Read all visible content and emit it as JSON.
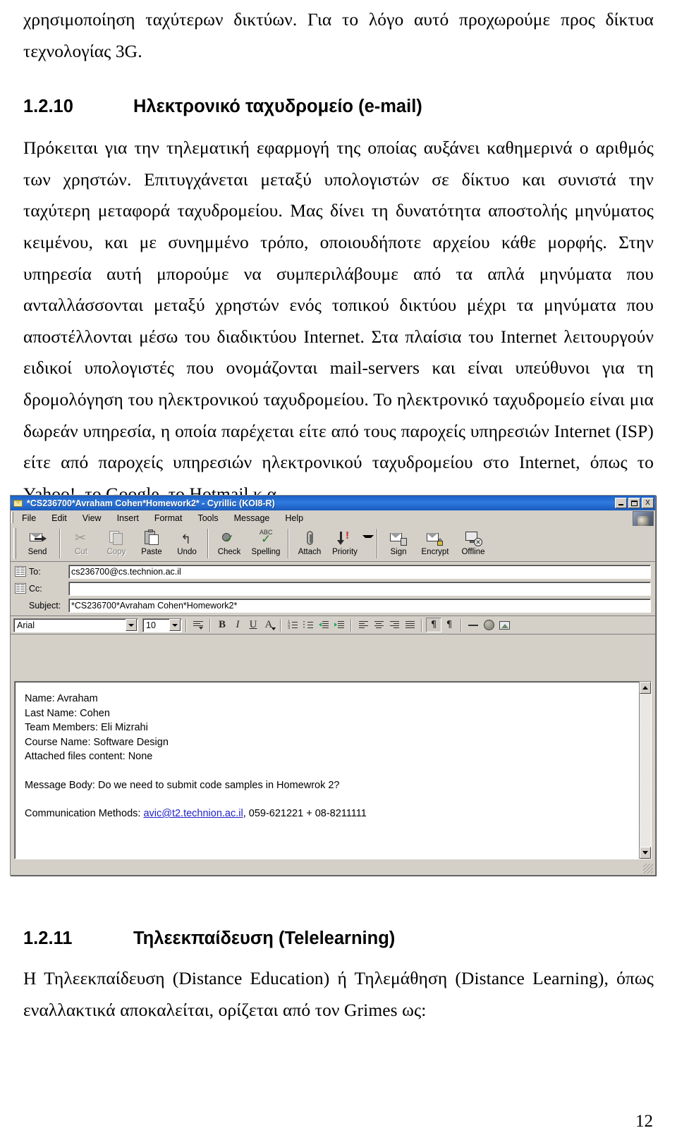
{
  "document": {
    "paragraph_intro": "χρησιμοποίηση ταχύτερων δικτύων. Για το λόγο αυτό προχωρούμε προς δίκτυα τεχνολογίας 3G.",
    "heading_1210": {
      "number": "1.2.10",
      "text": "Ηλεκτρονικό ταχυδρομείο (e-mail)"
    },
    "paragraph_body": "Πρόκειται για την τηλεματική εφαρμογή της οποίας αυξάνει καθημερινά ο αριθμός των χρηστών. Επιτυγχάνεται μεταξύ υπολογιστών σε δίκτυο και συνιστά την ταχύτερη μεταφορά ταχυδρομείου. Μας δίνει τη δυνατότητα αποστολής μηνύματος κειμένου, και με συνημμένο τρόπο, οποιουδήποτε αρχείου κάθε μορφής. Στην υπηρεσία αυτή μπορούμε να συμπεριλάβουμε από τα απλά μηνύματα που ανταλλάσσονται μεταξύ χρηστών ενός τοπικού δικτύου μέχρι τα μηνύματα που αποστέλλονται μέσω του διαδικτύου Internet. Στα πλαίσια του Internet λειτουργούν ειδικοί υπολογιστές που ονομάζονται mail-servers και είναι υπεύθυνοι για τη δρομολόγηση του ηλεκτρονικού ταχυδρομείου. Το ηλεκτρονικό ταχυδρομείο είναι μια δωρεάν υπηρεσία, η οποία παρέχεται είτε από τους παροχείς υπηρεσιών Internet (ISP) είτε από παροχείς υπηρεσιών ηλεκτρονικού ταχυδρομείου στο Internet, όπως το Yahoo!, το Google, το Hotmail κ.α.",
    "heading_1211": {
      "number": "1.2.11",
      "text": "Τηλεεκπαίδευση (Telelearning)"
    },
    "paragraph_tail": "Η Τηλεεκπαίδευση (Distance Education) ή Τηλεμάθηση (Distance Learning), όπως εναλλακτικά αποκαλείται, ορίζεται από τον Grimes ως:",
    "page_number": "12"
  },
  "mail_window": {
    "title": "*CS236700*Avraham Cohen*Homework2* - Cyrillic (KOI8-R)",
    "window_buttons": {
      "minimize": "_",
      "maximize": "□",
      "close": "X"
    },
    "menu": [
      {
        "label": "File",
        "accel": "F"
      },
      {
        "label": "Edit",
        "accel": "E"
      },
      {
        "label": "View",
        "accel": "V"
      },
      {
        "label": "Insert",
        "accel": "I"
      },
      {
        "label": "Format",
        "accel": "o"
      },
      {
        "label": "Tools",
        "accel": "T"
      },
      {
        "label": "Message",
        "accel": "M"
      },
      {
        "label": "Help",
        "accel": "H"
      }
    ],
    "toolbar": [
      {
        "label": "Send",
        "icon": "send-icon",
        "enabled": true
      },
      {
        "label": "Cut",
        "icon": "cut-icon",
        "enabled": false
      },
      {
        "label": "Copy",
        "icon": "copy-icon",
        "enabled": false
      },
      {
        "label": "Paste",
        "icon": "paste-icon",
        "enabled": true
      },
      {
        "label": "Undo",
        "icon": "undo-icon",
        "enabled": true
      },
      {
        "label": "Check",
        "icon": "check-names-icon",
        "enabled": true
      },
      {
        "label": "Spelling",
        "icon": "spelling-icon",
        "enabled": true
      },
      {
        "label": "Attach",
        "icon": "attach-icon",
        "enabled": true
      },
      {
        "label": "Priority",
        "icon": "priority-icon",
        "enabled": true
      },
      {
        "label": "Sign",
        "icon": "sign-icon",
        "enabled": true
      },
      {
        "label": "Encrypt",
        "icon": "encrypt-icon",
        "enabled": true
      },
      {
        "label": "Offline",
        "icon": "offline-icon",
        "enabled": true
      }
    ],
    "fields": {
      "to_label": "To:",
      "to_value": "cs236700@cs.technion.ac.il",
      "cc_label": "Cc:",
      "cc_value": "",
      "subject_label": "Subject:",
      "subject_value": "*CS236700*Avraham Cohen*Homework2*"
    },
    "format_toolbar": {
      "font_family": "Arial",
      "font_size": "10",
      "bold": "B",
      "italic": "I",
      "underline": "U",
      "font_color": "A"
    },
    "body": {
      "line_name": "Name: Avraham",
      "line_last_name": "Last Name: Cohen",
      "line_team": "Team Members: Eli Mizrahi",
      "line_course": "Course Name: Software Design",
      "line_attached": "Attached files content: None",
      "line_message": "Message Body: Do we need to submit code samples in Homewrok 2?",
      "line_comm_prefix": "Communication Methods: ",
      "line_comm_email": "avic@t2.technion.ac.il",
      "line_comm_suffix": ", 059-621221 + 08-8211111"
    }
  },
  "colors": {
    "titlebar": "#1b5fc1",
    "chrome": "#d4d0c8",
    "link": "#2222cc"
  }
}
